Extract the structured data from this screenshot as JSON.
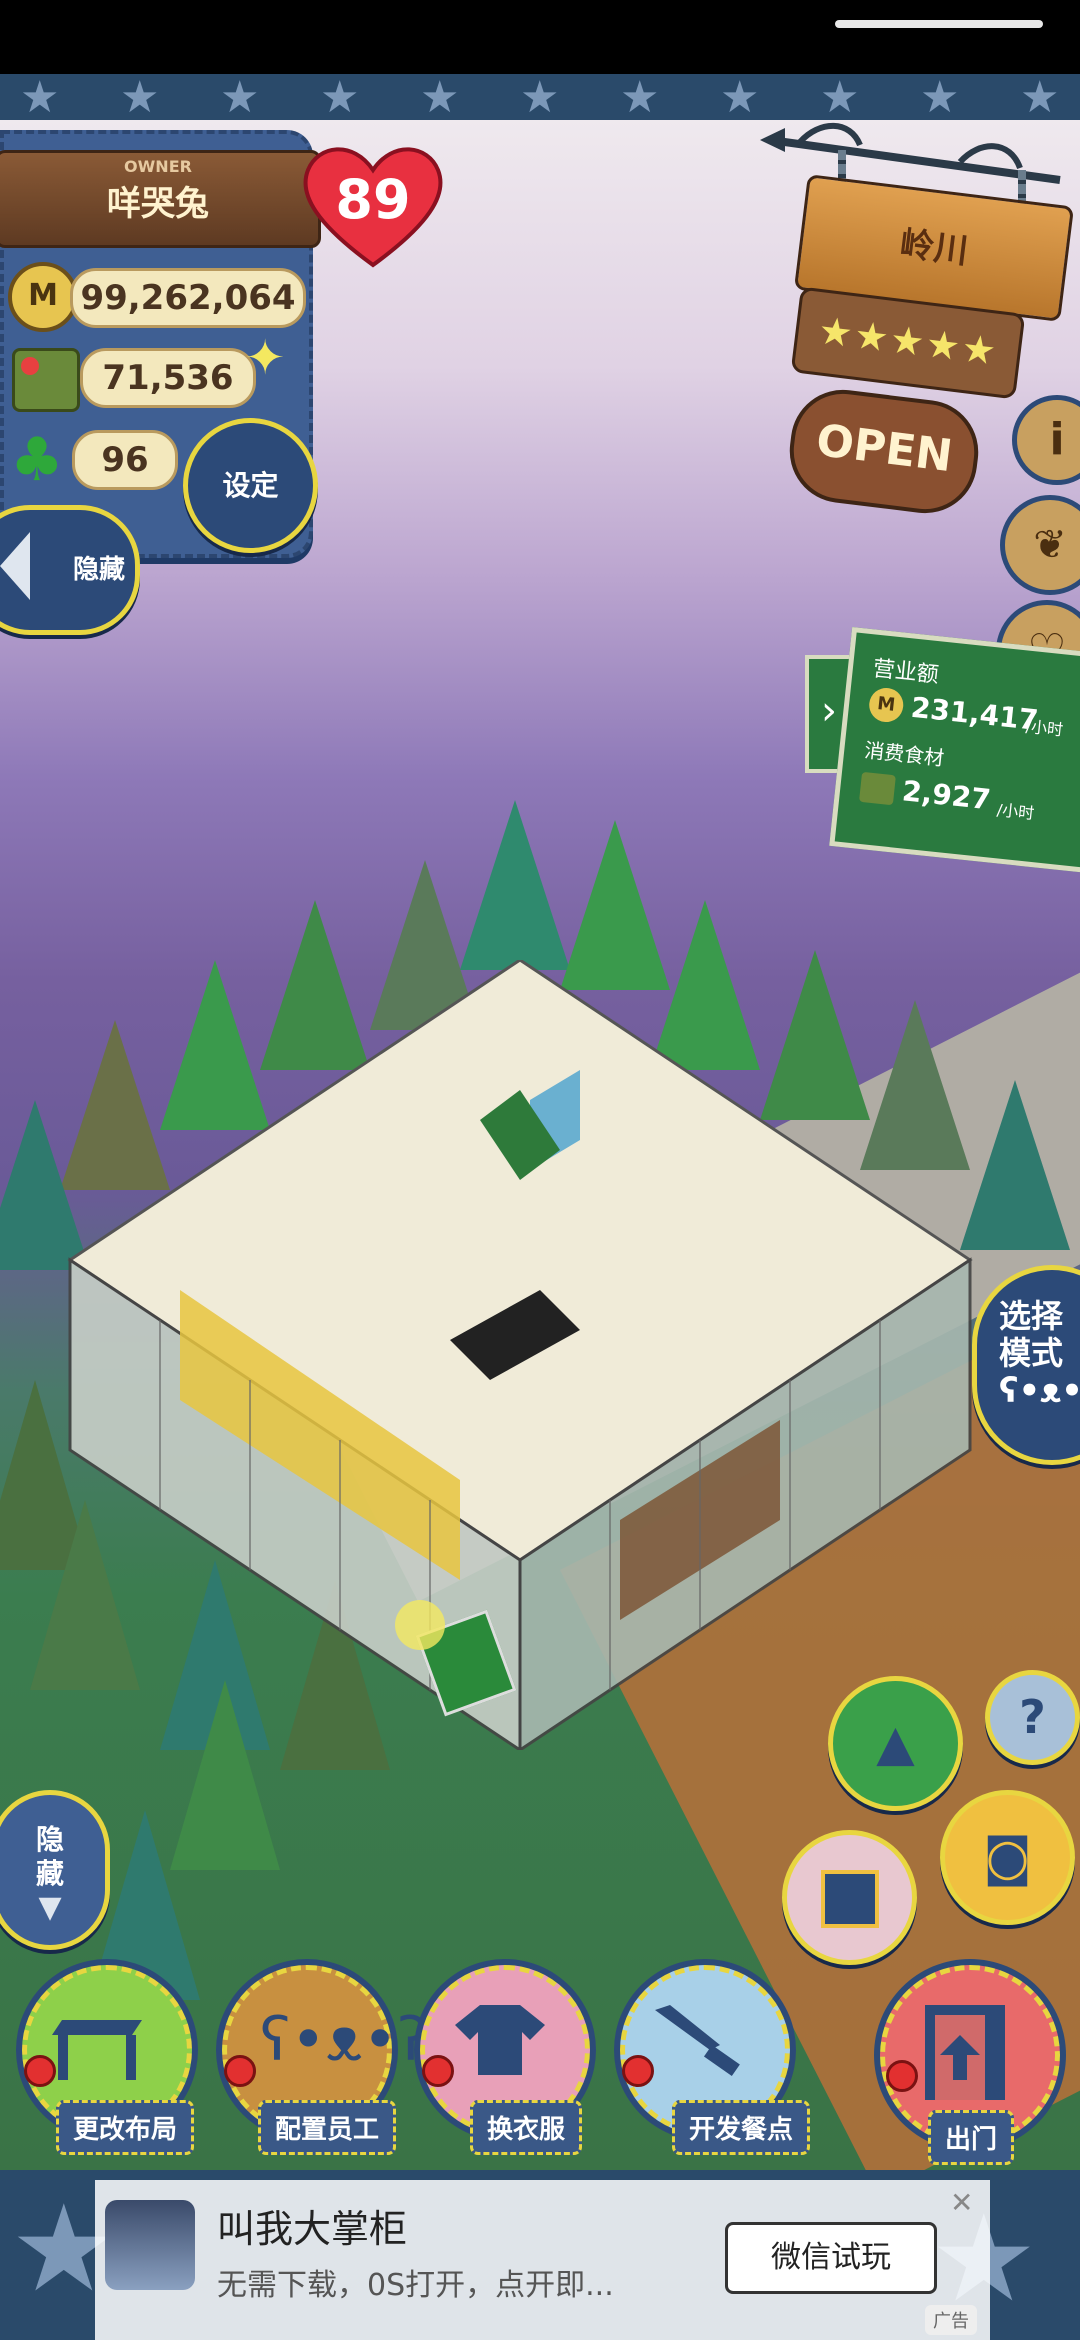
{
  "owner": {
    "tag": "OWNER",
    "name": "咩哭兔",
    "level": "89",
    "coins": "99,262,064",
    "ingredients": "71,536",
    "clover": "96",
    "settings_label": "设定",
    "hide_label": "隐藏"
  },
  "restaurant": {
    "name": "岭川",
    "stars": 5,
    "open_label": "OPEN"
  },
  "revenue": {
    "title": "营业额",
    "amount": "231,417",
    "unit": "/小时",
    "consume_title": "消费食材",
    "consume_amount": "2,927",
    "consume_unit": "/小时"
  },
  "side": {
    "mode_label_1": "选择",
    "mode_label_2": "模式",
    "hide_bottom_1": "隐",
    "hide_bottom_2": "藏",
    "help_symbol": "?"
  },
  "toolbar": {
    "items": [
      {
        "label": "更改布局",
        "icon": "table-icon"
      },
      {
        "label": "配置员工",
        "icon": "bear-head-icon"
      },
      {
        "label": "换衣服",
        "icon": "shirt-icon"
      },
      {
        "label": "开发餐点",
        "icon": "knife-icon"
      },
      {
        "label": "出门",
        "icon": "door-icon"
      }
    ]
  },
  "ad": {
    "title": "叫我大掌柜",
    "subtitle": "无需下载，0S打开，点开即...",
    "button": "微信试玩",
    "tag": "广告"
  },
  "colors": {
    "panel": "#3f5f93",
    "accent_yellow": "#e8d640",
    "wood": "#8a5a36",
    "board_green": "#2a7a3f"
  }
}
